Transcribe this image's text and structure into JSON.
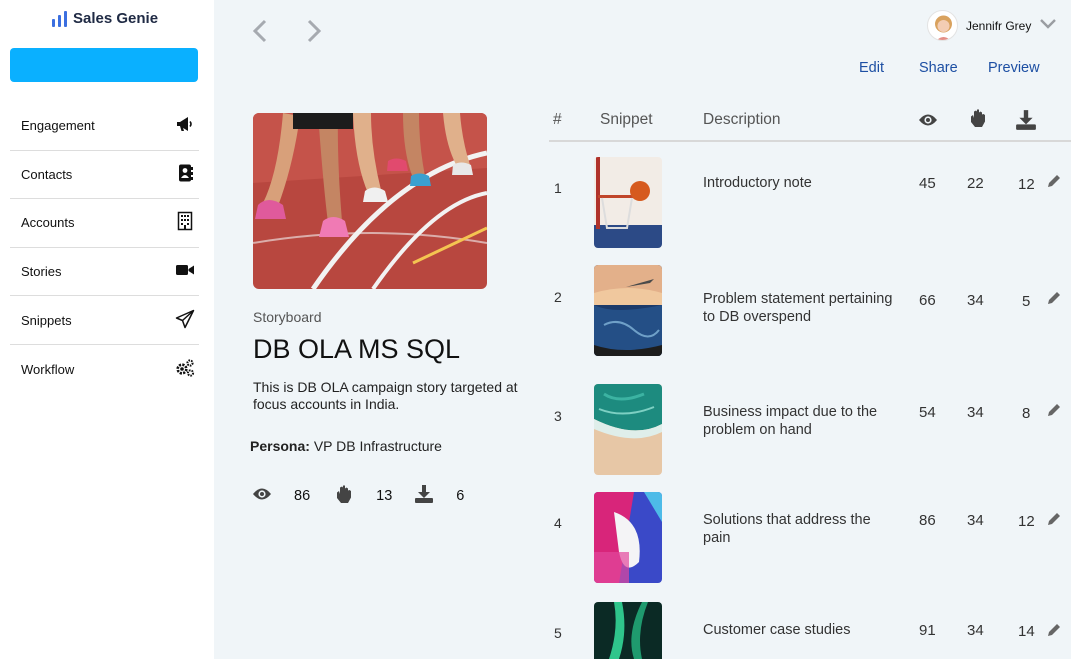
{
  "app": {
    "name": "Sales Genie",
    "primary_color": "#0ab0ff"
  },
  "sidebar": {
    "items": [
      {
        "label": "Engagement",
        "icon": "megaphone-icon"
      },
      {
        "label": "Contacts",
        "icon": "contacts-book-icon"
      },
      {
        "label": "Accounts",
        "icon": "building-icon"
      },
      {
        "label": "Stories",
        "icon": "video-camera-icon"
      },
      {
        "label": "Snippets",
        "icon": "paper-plane-icon"
      },
      {
        "label": "Workflow",
        "icon": "gears-icon"
      }
    ]
  },
  "user": {
    "name": "Jennifr Grey"
  },
  "actions": {
    "edit": "Edit",
    "share": "Share",
    "preview": "Preview"
  },
  "story": {
    "label": "Storyboard",
    "title": "DB OLA MS SQL",
    "description": "This is DB OLA campaign story targeted at focus accounts in India.",
    "persona_label": "Persona:",
    "persona_value": "VP DB Infrastructure",
    "views": "86",
    "engagements": "13",
    "downloads": "6"
  },
  "table": {
    "headers": {
      "num": "#",
      "snippet": "Snippet",
      "description": "Description"
    },
    "header_icons": [
      "eye-icon",
      "hand-icon",
      "download-icon"
    ],
    "rows": [
      {
        "num": "1",
        "description": "Introductory note",
        "views": "45",
        "engagements": "22",
        "downloads": "12"
      },
      {
        "num": "2",
        "description": "Problem statement pertaining to DB overspend",
        "views": "66",
        "engagements": "34",
        "downloads": "5"
      },
      {
        "num": "3",
        "description": "Business impact due to the problem on hand",
        "views": "54",
        "engagements": "34",
        "downloads": "8"
      },
      {
        "num": "4",
        "description": "Solutions that address the pain",
        "views": "86",
        "engagements": "34",
        "downloads": "12"
      },
      {
        "num": "5",
        "description": "Customer case studies",
        "views": "91",
        "engagements": "34",
        "downloads": "14"
      }
    ]
  }
}
